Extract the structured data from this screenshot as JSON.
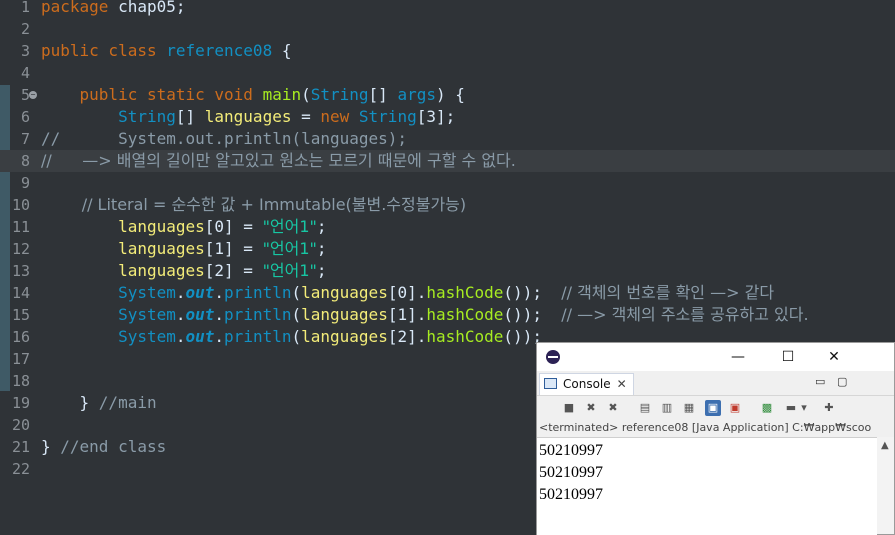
{
  "editor": {
    "lines": [
      {
        "n": "1",
        "parts": [
          {
            "c": "kw",
            "t": "package "
          },
          {
            "c": "pl",
            "t": "chap05;"
          }
        ]
      },
      {
        "n": "2",
        "parts": []
      },
      {
        "n": "3",
        "parts": [
          {
            "c": "kw",
            "t": "public class "
          },
          {
            "c": "ty",
            "t": "reference08"
          },
          {
            "c": "pl",
            "t": " {"
          }
        ]
      },
      {
        "n": "4",
        "parts": []
      },
      {
        "n": "5",
        "fold": true,
        "parts": [
          {
            "c": "kw",
            "t": "    public static void "
          },
          {
            "c": "fn",
            "t": "main"
          },
          {
            "c": "pl",
            "t": "("
          },
          {
            "c": "ty",
            "t": "String"
          },
          {
            "c": "pl",
            "t": "[] "
          },
          {
            "c": "ty",
            "t": "args"
          },
          {
            "c": "pl",
            "t": ") {"
          }
        ]
      },
      {
        "n": "6",
        "parts": [
          {
            "c": "ty",
            "t": "        String"
          },
          {
            "c": "pl",
            "t": "[] "
          },
          {
            "c": "var",
            "t": "languages"
          },
          {
            "c": "pl",
            "t": " = "
          },
          {
            "c": "kw",
            "t": "new "
          },
          {
            "c": "ty",
            "t": "String"
          },
          {
            "c": "pl",
            "t": "[3];"
          }
        ]
      },
      {
        "n": "7",
        "parts": [
          {
            "c": "cm",
            "t": "//      System.out.println(languages);"
          }
        ]
      },
      {
        "n": "8",
        "hl": true,
        "parts": [
          {
            "c": "cm",
            "t": "//      —> 배열의 길이만 알고있고 원소는 모르기 때문에 구할 수 없다."
          }
        ]
      },
      {
        "n": "9",
        "parts": []
      },
      {
        "n": "10",
        "parts": [
          {
            "c": "cm",
            "t": "        // Literal = 순수한 값 + Immutable(불변.수정불가능)"
          }
        ]
      },
      {
        "n": "11",
        "parts": [
          {
            "c": "var",
            "t": "        languages"
          },
          {
            "c": "pl",
            "t": "[0] = "
          },
          {
            "c": "str",
            "t": "\"언어1\""
          },
          {
            "c": "pl",
            "t": ";"
          }
        ]
      },
      {
        "n": "12",
        "parts": [
          {
            "c": "var",
            "t": "        languages"
          },
          {
            "c": "pl",
            "t": "[1] = "
          },
          {
            "c": "str",
            "t": "\"언어1\""
          },
          {
            "c": "pl",
            "t": ";"
          }
        ]
      },
      {
        "n": "13",
        "parts": [
          {
            "c": "var",
            "t": "        languages"
          },
          {
            "c": "pl",
            "t": "[2] = "
          },
          {
            "c": "str",
            "t": "\"언어1\""
          },
          {
            "c": "pl",
            "t": ";"
          }
        ]
      },
      {
        "n": "14",
        "parts": [
          {
            "c": "ty",
            "t": "        System"
          },
          {
            "c": "pl",
            "t": "."
          },
          {
            "c": "sf",
            "t": "out"
          },
          {
            "c": "pl",
            "t": "."
          },
          {
            "c": "ty",
            "t": "println"
          },
          {
            "c": "pl",
            "t": "("
          },
          {
            "c": "var",
            "t": "languages"
          },
          {
            "c": "pl",
            "t": "[0]."
          },
          {
            "c": "fn",
            "t": "hashCode"
          },
          {
            "c": "pl",
            "t": "());  "
          },
          {
            "c": "cm",
            "t": "// 객체의 번호를 확인 —> 같다"
          }
        ]
      },
      {
        "n": "15",
        "parts": [
          {
            "c": "ty",
            "t": "        System"
          },
          {
            "c": "pl",
            "t": "."
          },
          {
            "c": "sf",
            "t": "out"
          },
          {
            "c": "pl",
            "t": "."
          },
          {
            "c": "ty",
            "t": "println"
          },
          {
            "c": "pl",
            "t": "("
          },
          {
            "c": "var",
            "t": "languages"
          },
          {
            "c": "pl",
            "t": "[1]."
          },
          {
            "c": "fn",
            "t": "hashCode"
          },
          {
            "c": "pl",
            "t": "());  "
          },
          {
            "c": "cm",
            "t": "// —> 객체의 주소를 공유하고 있다."
          }
        ]
      },
      {
        "n": "16",
        "parts": [
          {
            "c": "ty",
            "t": "        System"
          },
          {
            "c": "pl",
            "t": "."
          },
          {
            "c": "sf",
            "t": "out"
          },
          {
            "c": "pl",
            "t": "."
          },
          {
            "c": "ty",
            "t": "println"
          },
          {
            "c": "pl",
            "t": "("
          },
          {
            "c": "var",
            "t": "languages"
          },
          {
            "c": "pl",
            "t": "[2]."
          },
          {
            "c": "fn",
            "t": "hashCode"
          },
          {
            "c": "pl",
            "t": "());"
          }
        ]
      },
      {
        "n": "17",
        "parts": []
      },
      {
        "n": "18",
        "parts": []
      },
      {
        "n": "19",
        "parts": [
          {
            "c": "pl",
            "t": "    } "
          },
          {
            "c": "cm",
            "t": "//main"
          }
        ]
      },
      {
        "n": "20",
        "parts": []
      },
      {
        "n": "21",
        "parts": [
          {
            "c": "pl",
            "t": "} "
          },
          {
            "c": "cm",
            "t": "//end class"
          }
        ]
      },
      {
        "n": "22",
        "parts": []
      }
    ]
  },
  "console_window": {
    "minimize": "—",
    "maximize": "☐",
    "close": "✕",
    "tab_label": "Console",
    "tab_close": "✕",
    "label": "<terminated> reference08 [Java Application] C:₩app₩scoo",
    "output": [
      "50210997",
      "50210997",
      "50210997"
    ]
  }
}
